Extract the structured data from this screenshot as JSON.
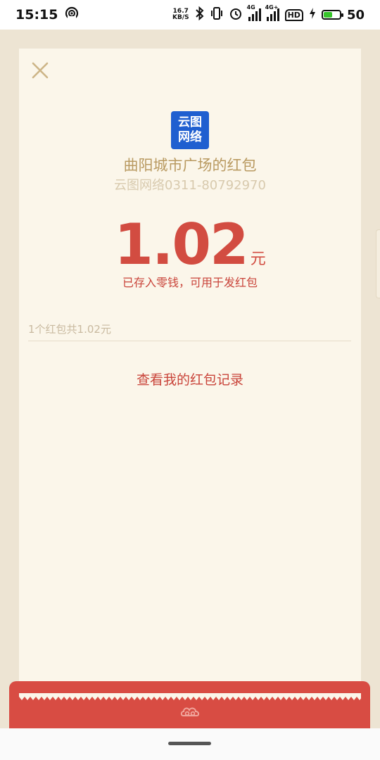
{
  "statusbar": {
    "time": "15:15",
    "net_speed_value": "16.7",
    "net_speed_unit": "KB/S",
    "sig1_label": "4G",
    "sig2_label": "4G+",
    "hd_label": "HD",
    "battery_level": "50",
    "battery_fill": 0.5,
    "icons": [
      "hotspot-icon",
      "bluetooth-icon",
      "vibrate-icon",
      "alarm-icon",
      "signal-icon",
      "signal-icon",
      "hd-voice-icon",
      "charging-icon",
      "battery-icon"
    ]
  },
  "logo": {
    "line1": "云图",
    "line2": "网络",
    "color": "#1f5fd0"
  },
  "packet": {
    "sender": "曲阳城市广场的红包",
    "phone": "云图网络0311-80792970",
    "amount": "1.02",
    "unit": "元",
    "notice": "已存入零钱，可用于发红包",
    "summary": "1个红包共1.02元",
    "records_link": "查看我的红包记录"
  },
  "colors": {
    "accent_red": "#d24c41",
    "gold_text": "#b99a61",
    "card_bg": "#fbf6ea",
    "page_bg": "#ede4d3"
  }
}
